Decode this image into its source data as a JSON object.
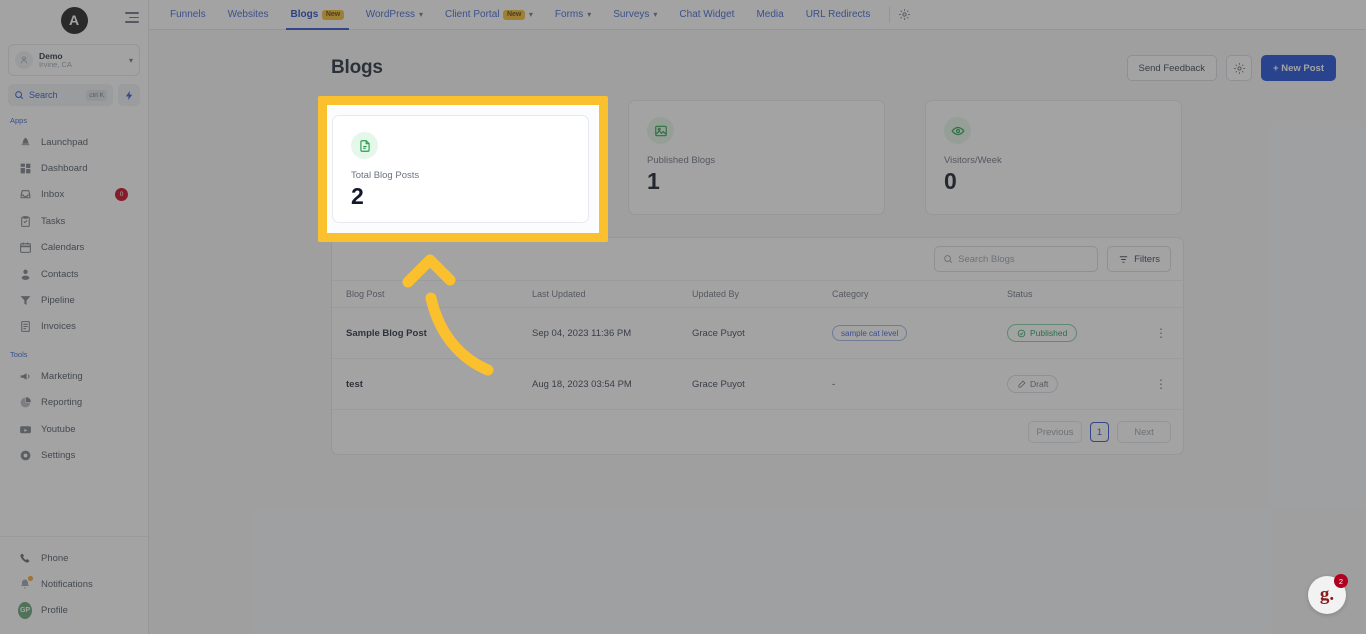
{
  "sidebar": {
    "logo_letter": "A",
    "location": {
      "name": "Demo",
      "sub": "Irvine, CA"
    },
    "search": {
      "label": "Search",
      "shortcut": "ctrl K"
    },
    "section_apps": "Apps",
    "section_tools": "Tools",
    "apps": [
      {
        "label": "Launchpad",
        "icon": "rocket-icon"
      },
      {
        "label": "Dashboard",
        "icon": "grid-icon"
      },
      {
        "label": "Inbox",
        "icon": "inbox-icon",
        "badge": "0"
      },
      {
        "label": "Tasks",
        "icon": "clipboard-icon"
      },
      {
        "label": "Calendars",
        "icon": "calendar-icon"
      },
      {
        "label": "Contacts",
        "icon": "person-icon"
      },
      {
        "label": "Pipeline",
        "icon": "filter-funnel-icon"
      },
      {
        "label": "Invoices",
        "icon": "invoice-icon"
      }
    ],
    "tools": [
      {
        "label": "Marketing",
        "icon": "megaphone-icon"
      },
      {
        "label": "Reporting",
        "icon": "pie-chart-icon"
      },
      {
        "label": "Youtube",
        "icon": "video-icon"
      },
      {
        "label": "Settings",
        "icon": "gear-icon"
      }
    ],
    "bottom": [
      {
        "label": "Phone",
        "icon": "phone-icon"
      },
      {
        "label": "Notifications",
        "icon": "bell-icon"
      },
      {
        "label": "Profile",
        "icon": "avatar-icon",
        "initials": "GP"
      }
    ]
  },
  "topbar": {
    "tabs": [
      {
        "label": "Funnels",
        "badge": "",
        "caret": false,
        "active": false
      },
      {
        "label": "Websites",
        "badge": "",
        "caret": false,
        "active": false
      },
      {
        "label": "Blogs",
        "badge": "New",
        "caret": false,
        "active": true
      },
      {
        "label": "WordPress",
        "badge": "",
        "caret": true,
        "active": false
      },
      {
        "label": "Client Portal",
        "badge": "New",
        "caret": true,
        "active": false
      },
      {
        "label": "Forms",
        "badge": "",
        "caret": true,
        "active": false
      },
      {
        "label": "Surveys",
        "badge": "",
        "caret": true,
        "active": false
      },
      {
        "label": "Chat Widget",
        "badge": "",
        "caret": false,
        "active": false
      },
      {
        "label": "Media",
        "badge": "",
        "caret": false,
        "active": false
      },
      {
        "label": "URL Redirects",
        "badge": "",
        "caret": false,
        "active": false
      }
    ],
    "settings_icon": "gear-icon"
  },
  "page": {
    "title": "Blogs",
    "send_feedback_label": "Send Feedback",
    "settings_icon": "gear-icon",
    "new_post_label": "+ New Post"
  },
  "cards": [
    {
      "label": "Total Blog Posts",
      "value": "2",
      "icon": "document-icon"
    },
    {
      "label": "Published Blogs",
      "value": "1",
      "icon": "image-icon"
    },
    {
      "label": "Visitors/Week",
      "value": "0",
      "icon": "eye-icon"
    }
  ],
  "table": {
    "search_placeholder": "Search Blogs",
    "filters_label": "Filters",
    "headers": [
      "Blog Post",
      "Last Updated",
      "Updated By",
      "Category",
      "Status",
      ""
    ],
    "rows": [
      {
        "title": "Sample Blog Post",
        "last_updated": "Sep 04, 2023 11:36 PM",
        "updated_by": "Grace Puyot",
        "category": "sample cat level",
        "status": "Published",
        "status_kind": "published"
      },
      {
        "title": "test",
        "last_updated": "Aug 18, 2023 03:54 PM",
        "updated_by": "Grace Puyot",
        "category": "-",
        "status": "Draft",
        "status_kind": "draft"
      }
    ],
    "pagination": {
      "previous": "Previous",
      "page": "1",
      "next": "Next"
    }
  },
  "support_widget": {
    "logo": "g.",
    "badge": "2"
  },
  "colors": {
    "accent": "#1b4bd8",
    "highlight": "#fbc02d",
    "green": "#27a04a",
    "danger": "#c4001a"
  }
}
